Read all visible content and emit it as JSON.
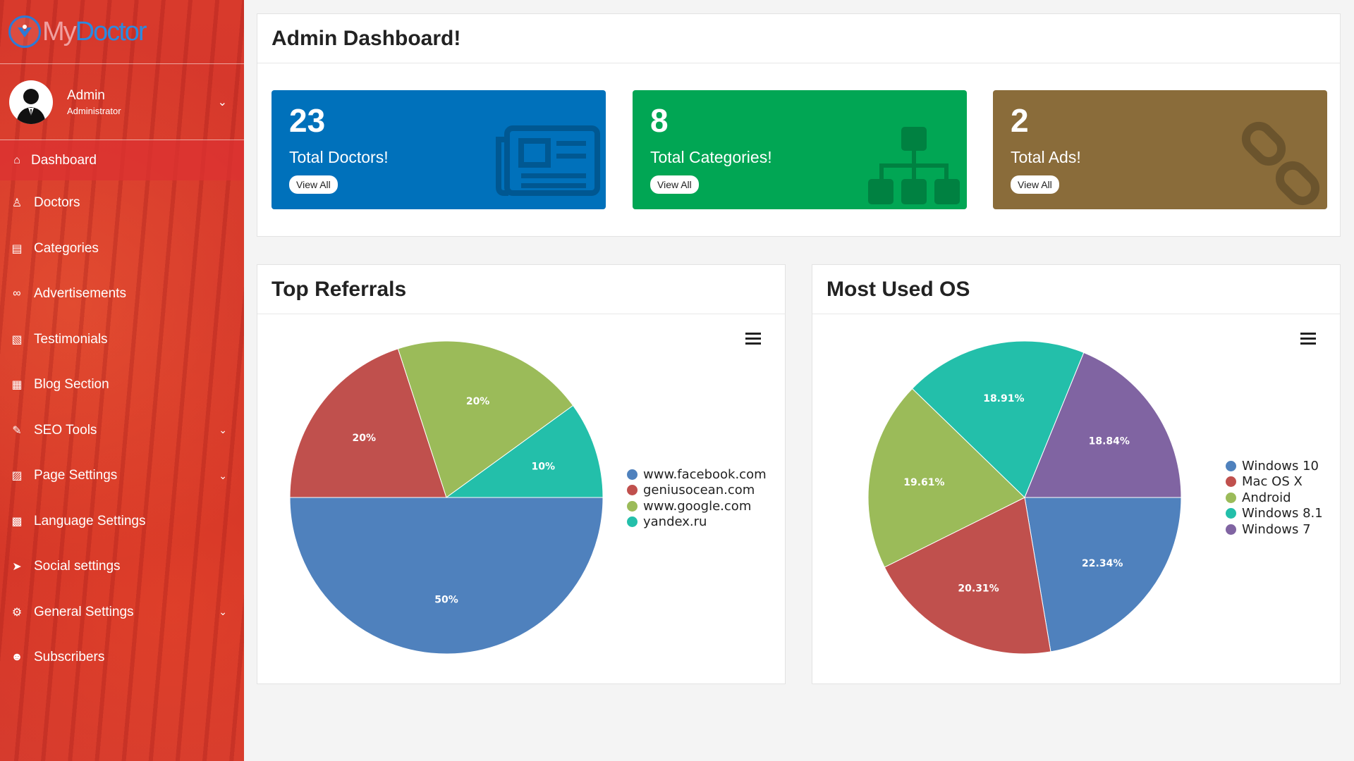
{
  "brand": {
    "name_part1": "My",
    "name_part2": "Doctor"
  },
  "user": {
    "name": "Admin",
    "role": "Administrator"
  },
  "nav": [
    {
      "label": "Dashboard",
      "icon": "home-icon",
      "glyph": "⌂",
      "active": true,
      "caret": false
    },
    {
      "label": "Doctors",
      "icon": "user-md-icon",
      "glyph": "♙",
      "caret": false
    },
    {
      "label": "Categories",
      "icon": "clipboard-icon",
      "glyph": "▤",
      "caret": false
    },
    {
      "label": "Advertisements",
      "icon": "link-icon",
      "glyph": "∞",
      "caret": false
    },
    {
      "label": "Testimonials",
      "icon": "image-file-icon",
      "glyph": "▧",
      "caret": false
    },
    {
      "label": "Blog Section",
      "icon": "file-text-icon",
      "glyph": "▦",
      "caret": false
    },
    {
      "label": "SEO Tools",
      "icon": "wrench-icon",
      "glyph": "✎",
      "caret": true
    },
    {
      "label": "Page Settings",
      "icon": "page-settings-icon",
      "glyph": "▨",
      "caret": true
    },
    {
      "label": "Language Settings",
      "icon": "language-icon",
      "glyph": "▩",
      "caret": false
    },
    {
      "label": "Social settings",
      "icon": "paper-plane-icon",
      "glyph": "➤",
      "caret": false
    },
    {
      "label": "General Settings",
      "icon": "cogs-icon",
      "glyph": "⚙",
      "caret": true
    },
    {
      "label": "Subscribers",
      "icon": "users-icon",
      "glyph": "☻",
      "caret": false
    }
  ],
  "dashboard": {
    "title": "Admin Dashboard!",
    "stats": [
      {
        "value": "23",
        "label": "Total Doctors!",
        "button": "View All",
        "color": "#0071bb",
        "icon": "newspaper-icon"
      },
      {
        "value": "8",
        "label": "Total Categories!",
        "button": "View All",
        "color": "#01a654",
        "icon": "sitemap-icon"
      },
      {
        "value": "2",
        "label": "Total Ads!",
        "button": "View All",
        "color": "#8a6c3a",
        "icon": "chain-icon"
      }
    ]
  },
  "chart_data": [
    {
      "type": "pie",
      "title": "Top Referrals",
      "categories": [
        "www.facebook.com",
        "geniusocean.com",
        "www.google.com",
        "yandex.ru"
      ],
      "values": [
        50,
        20,
        20,
        10
      ],
      "labels": [
        "50%",
        "20%",
        "20%",
        "10%"
      ],
      "colors": [
        "#4f81bd",
        "#c0504d",
        "#9bbb59",
        "#23bfaa"
      ],
      "legend": "right"
    },
    {
      "type": "pie",
      "title": "Most Used OS",
      "categories": [
        "Windows 10",
        "Mac OS X",
        "Android",
        "Windows 8.1",
        "Windows 7"
      ],
      "values": [
        22.34,
        20.31,
        19.61,
        18.91,
        18.84
      ],
      "labels": [
        "22.34%",
        "20.31%",
        "19.61%",
        "18.91%",
        "18.84%"
      ],
      "colors": [
        "#4f81bd",
        "#c0504d",
        "#9bbb59",
        "#23bfaa",
        "#8064a2"
      ],
      "legend": "right"
    }
  ]
}
